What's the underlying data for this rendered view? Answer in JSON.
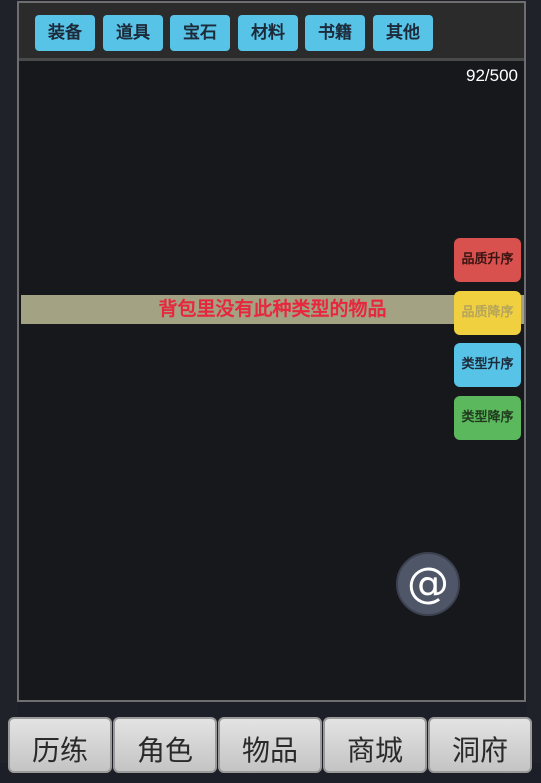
{
  "tabs": [
    "装备",
    "道具",
    "宝石",
    "材料",
    "书籍",
    "其他"
  ],
  "inventory": {
    "count": "92/500"
  },
  "empty_message": "背包里没有此种类型的物品",
  "sort_buttons": [
    {
      "label": "品质升序",
      "color": "#d9514e",
      "text_color": "#3a1412"
    },
    {
      "label": "品质降序",
      "color": "#f0d03f",
      "text_color": "#b6a55a"
    },
    {
      "label": "类型升序",
      "color": "#57c3e6",
      "text_color": "#1d2a3a"
    },
    {
      "label": "类型降序",
      "color": "#5cb85c",
      "text_color": "#1f3a1f"
    }
  ],
  "chat_button": {
    "icon": "at-icon",
    "glyph": "@"
  },
  "bottom_nav": [
    "历练",
    "角色",
    "物品",
    "商城",
    "洞府"
  ],
  "colors": {
    "tab_bg": "#57c3e6",
    "panel_bg": "#17181c",
    "message_text": "#e8263d"
  }
}
